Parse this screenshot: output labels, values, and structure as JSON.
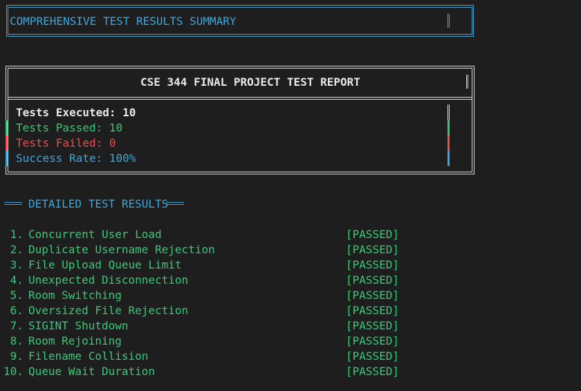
{
  "header": {
    "title": "COMPREHENSIVE TEST RESULTS SUMMARY"
  },
  "report": {
    "title": "CSE 344 FINAL PROJECT TEST REPORT",
    "executed": "Tests Executed: 10",
    "passed": "Tests Passed: 10",
    "failed": "Tests Failed: 0",
    "rate": "Success Rate: 100%"
  },
  "detail": {
    "heading": "DETAILED TEST RESULTS",
    "tests": [
      {
        "num": " 1.",
        "name": "Concurrent User Load",
        "status": "[PASSED]"
      },
      {
        "num": " 2.",
        "name": "Duplicate Username Rejection",
        "status": "[PASSED]"
      },
      {
        "num": " 3.",
        "name": "File Upload Queue Limit",
        "status": "[PASSED]"
      },
      {
        "num": " 4.",
        "name": "Unexpected Disconnection",
        "status": "[PASSED]"
      },
      {
        "num": " 5.",
        "name": "Room Switching",
        "status": "[PASSED]"
      },
      {
        "num": " 6.",
        "name": "Oversized File Rejection",
        "status": "[PASSED]"
      },
      {
        "num": " 7.",
        "name": "SIGINT Shutdown",
        "status": "[PASSED]"
      },
      {
        "num": " 8.",
        "name": "Room Rejoining",
        "status": "[PASSED]"
      },
      {
        "num": " 9.",
        "name": "Filename Collision",
        "status": "[PASSED]"
      },
      {
        "num": "10.",
        "name": "Queue Wait Duration",
        "status": "[PASSED]"
      }
    ]
  },
  "colors": {
    "background": "#1e1e1e",
    "accent": "#3ba7dc",
    "pass": "#3bc77a",
    "fail": "#f14c4c",
    "text": "#e8e8e8"
  }
}
